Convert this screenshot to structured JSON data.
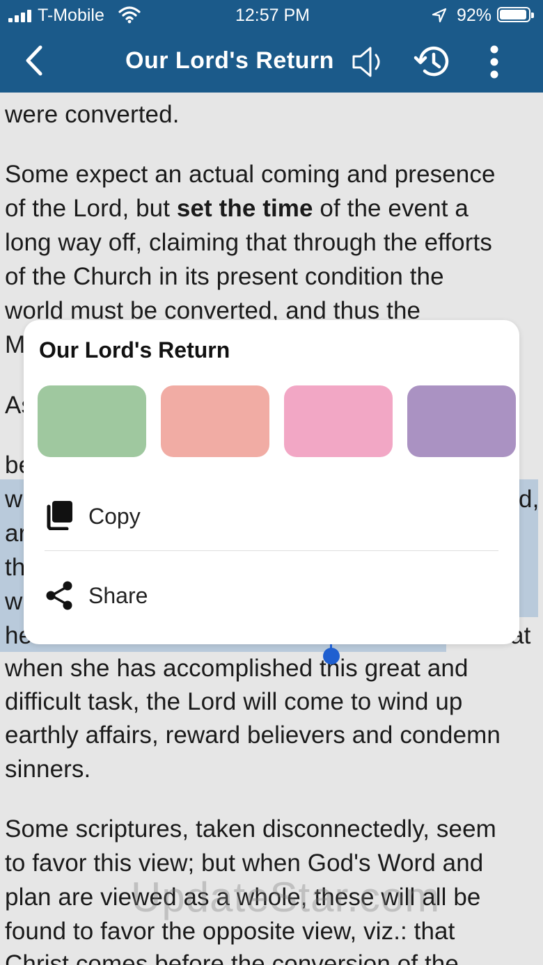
{
  "status_bar": {
    "carrier": "T-Mobile",
    "time": "12:57 PM",
    "battery": "92%",
    "battery_level": 0.92
  },
  "app_bar": {
    "title": "Our Lord's Return",
    "icons": [
      "chevron-left-icon",
      "speaker-icon",
      "history-icon",
      "more-vertical-icon"
    ]
  },
  "content": {
    "lines": [
      "were converted.",
      "Some expect an actual coming and presence",
      "world must be converted, and thus the",
      "M",
      "As",
      "be",
      "w",
      "d,",
      "ar",
      "th",
      "w",
      "he",
      "at",
      "when she has accomplished this great and",
      "difficult task, the Lord will come to wind up",
      "earthly affairs, reward believers and condemn",
      "sinners.",
      "Some scriptures, taken disconnectedly, seem",
      "to favor this view; but when God's Word and",
      "plan are viewed as a whole, these will all be",
      "found to favor the opposite view, viz.: that",
      "Christ comes before the conversion of the"
    ],
    "line3_before": "of the Lord, but ",
    "line3_bold": "set the time",
    "line3_after": " of the event a",
    "line4": "long way off, claiming that through the efforts",
    "line5": "of the Church in its present condition the"
  },
  "popup": {
    "title": "Our Lord's Return",
    "swatches": [
      {
        "name": "green",
        "color": "#9fc89f"
      },
      {
        "name": "salmon",
        "color": "#f1aca4"
      },
      {
        "name": "pink",
        "color": "#f2a7c5"
      },
      {
        "name": "purple",
        "color": "#aa92c2"
      }
    ],
    "copy_label": "Copy",
    "share_label": "Share"
  },
  "watermark": "UpdateStar.com",
  "colors": {
    "app_bar": "#1b5a8a",
    "background": "#e6e6e6",
    "selection": "#b9cadb",
    "handle": "#1f5fd0"
  }
}
